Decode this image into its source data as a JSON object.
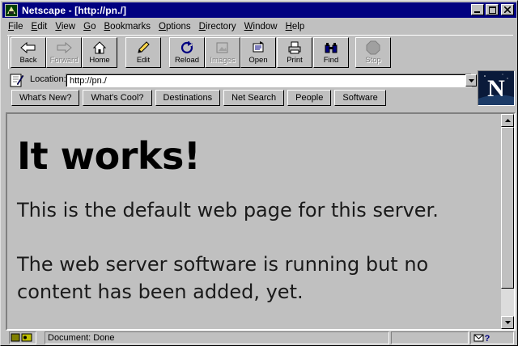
{
  "window": {
    "title": "Netscape - [http://pn./]"
  },
  "menu": [
    "File",
    "Edit",
    "View",
    "Go",
    "Bookmarks",
    "Options",
    "Directory",
    "Window",
    "Help"
  ],
  "toolbar": {
    "back": "Back",
    "forward": "Forward",
    "home": "Home",
    "edit": "Edit",
    "reload": "Reload",
    "images": "Images",
    "open": "Open",
    "print": "Print",
    "find": "Find",
    "stop": "Stop"
  },
  "location": {
    "label": "Location:",
    "url": "http://pn./"
  },
  "directory_buttons": [
    "What's New?",
    "What's Cool?",
    "Destinations",
    "Net Search",
    "People",
    "Software"
  ],
  "logo": {
    "letter": "N"
  },
  "page": {
    "heading": "It works!",
    "para1": "This is the default web page for this server.",
    "para2": "The web server software is running but no content has been added, yet."
  },
  "status": {
    "text": "Document: Done"
  },
  "colors": {
    "titlebar": "#000080",
    "chrome": "#c0c0c0",
    "logo_bg": "#0a1a3a"
  }
}
